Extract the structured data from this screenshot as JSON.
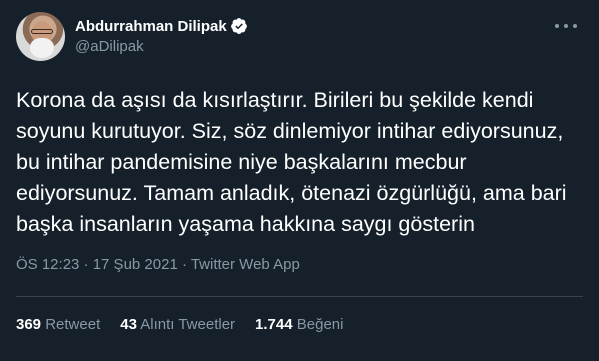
{
  "author": {
    "name": "Abdurrahman Dilipak",
    "handle": "@aDilipak",
    "verified": true
  },
  "tweet": {
    "text": "Korona da aşısı da kısırlaştırır. Birileri bu şekilde kendi soyunu kurutuyor. Siz, söz dinlemiyor intihar ediyorsunuz, bu intihar pandemisine niye başkalarını mecbur ediyorsunuz. Tamam anladık, ötenazi özgürlüğü, ama bari başka insanların yaşama hakkına saygı gösterin",
    "meta": "ÖS 12:23 · 17 Şub 2021 · Twitter Web App"
  },
  "stats": {
    "retweets_count": "369",
    "retweets_label": "Retweet",
    "quotes_count": "43",
    "quotes_label": "Alıntı Tweetler",
    "likes_count": "1.744",
    "likes_label": "Beğeni"
  },
  "colors": {
    "background": "#15202b",
    "secondary_text": "#8899a6",
    "verified_blue": "#ffffff",
    "divider": "#38444d"
  },
  "icons": {
    "verified": "verified-badge-icon",
    "more": "more-options-icon"
  }
}
